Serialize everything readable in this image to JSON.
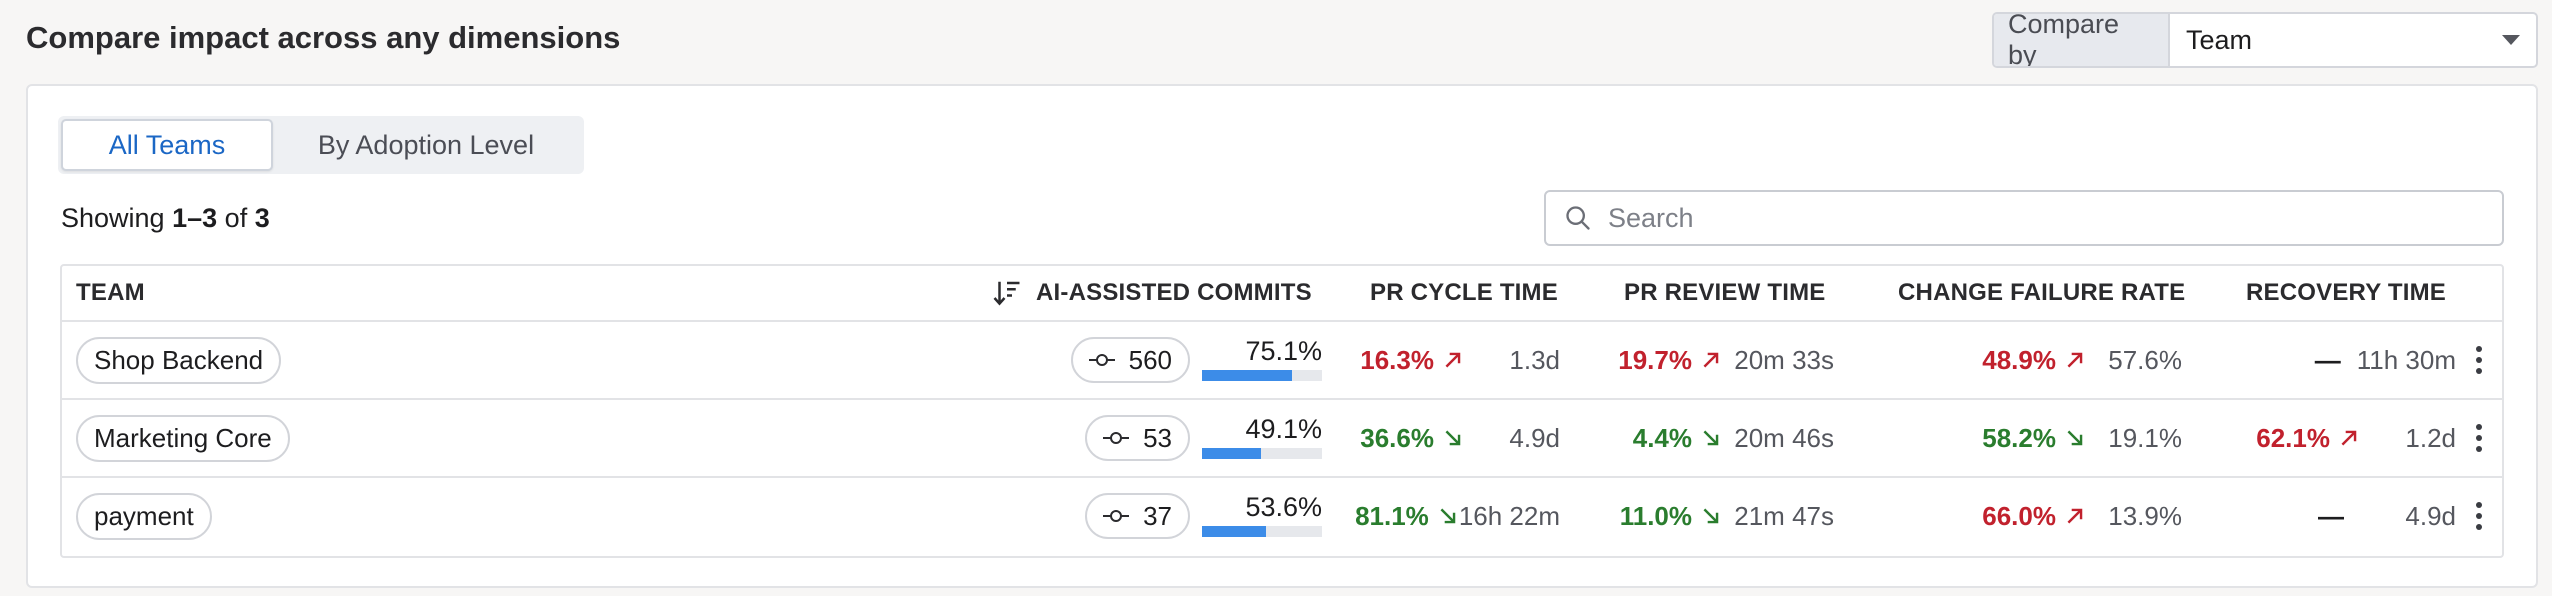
{
  "header": {
    "title": "Compare impact across any dimensions"
  },
  "compare": {
    "label": "Compare by",
    "value": "Team"
  },
  "tabs": [
    {
      "label": "All Teams",
      "active": true
    },
    {
      "label": "By Adoption Level",
      "active": false
    }
  ],
  "showing": {
    "prefix": "Showing",
    "range": "1–3",
    "of": "of",
    "total": "3"
  },
  "search": {
    "placeholder": "Search"
  },
  "columns": {
    "team": "TEAM",
    "ai_commits": "AI-ASSISTED COMMITS",
    "pr_cycle": "PR CYCLE TIME",
    "pr_review": "PR REVIEW TIME",
    "cfr": "CHANGE FAILURE RATE",
    "recovery": "RECOVERY TIME"
  },
  "rows": [
    {
      "team": "Shop Backend",
      "commits": "560",
      "ai_pct": "75.1%",
      "ai_fraction": 0.751,
      "cycle_delta": "16.3%",
      "cycle_trend": "up",
      "cycle_value": "1.3d",
      "review_delta": "19.7%",
      "review_trend": "up",
      "review_value": "20m 33s",
      "cfr_delta": "48.9%",
      "cfr_trend": "up",
      "cfr_value": "57.6%",
      "rec_delta": "—",
      "rec_trend": "none",
      "rec_value": "11h 30m"
    },
    {
      "team": "Marketing Core",
      "commits": "53",
      "ai_pct": "49.1%",
      "ai_fraction": 0.491,
      "cycle_delta": "36.6%",
      "cycle_trend": "down",
      "cycle_value": "4.9d",
      "review_delta": "4.4%",
      "review_trend": "down",
      "review_value": "20m 46s",
      "cfr_delta": "58.2%",
      "cfr_trend": "down",
      "cfr_value": "19.1%",
      "rec_delta": "62.1%",
      "rec_trend": "up",
      "rec_value": "1.2d"
    },
    {
      "team": "payment",
      "commits": "37",
      "ai_pct": "53.6%",
      "ai_fraction": 0.536,
      "cycle_delta": "81.1%",
      "cycle_trend": "down",
      "cycle_value": "16h 22m",
      "review_delta": "11.0%",
      "review_trend": "down",
      "review_value": "21m 47s",
      "cfr_delta": "66.0%",
      "cfr_trend": "up",
      "cfr_value": "13.9%",
      "rec_delta": "—",
      "rec_trend": "none",
      "rec_value": "4.9d"
    }
  ],
  "colors": {
    "bad": "#c1212d",
    "good": "#2a7d2e",
    "bar": "#3c8ce8",
    "accent": "#1b67c5"
  },
  "icons": {
    "sort": "sort-descending-icon",
    "commit": "git-commit-icon",
    "search": "search-icon",
    "menu": "kebab-menu-icon",
    "dropdown": "caret-down-icon"
  }
}
